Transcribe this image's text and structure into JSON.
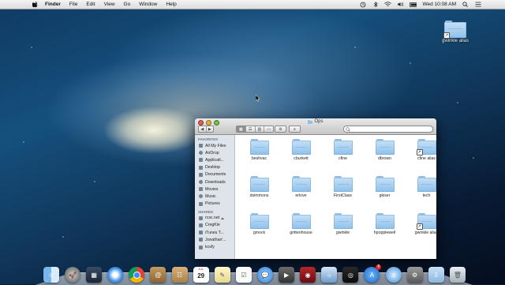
{
  "menubar": {
    "app_name": "Finder",
    "items": [
      "File",
      "Edit",
      "View",
      "Go",
      "Window",
      "Help"
    ],
    "clock": "Wed 10:08 AM"
  },
  "desktop_item": {
    "label": "gwinkle alias"
  },
  "window": {
    "title": "Ops",
    "search_placeholder": ""
  },
  "sidebar": {
    "favorites_heading": "FAVORITES",
    "favorites": [
      "All My Files",
      "AirDrop",
      "Applicati...",
      "Desktop",
      "Documents",
      "Downloads",
      "Movies",
      "Music",
      "Pictures"
    ],
    "shared_heading": "SHARED",
    "shared": [
      "rcsc.net",
      "CregKle",
      "iTunes T...",
      "Jonathan'...",
      "kcsfy"
    ]
  },
  "folders": [
    {
      "label": "beshvac",
      "alias": false
    },
    {
      "label": "cburkett",
      "alias": false
    },
    {
      "label": "cfine",
      "alias": false
    },
    {
      "label": "dbrown",
      "alias": false
    },
    {
      "label": "cfine alias",
      "alias": true
    },
    {
      "label": "dsimmons",
      "alias": false
    },
    {
      "label": "erlove",
      "alias": false
    },
    {
      "label": "FirstClass",
      "alias": false
    },
    {
      "label": "gkiser",
      "alias": false
    },
    {
      "label": "tech",
      "alias": false
    },
    {
      "label": "gmock",
      "alias": false
    },
    {
      "label": "grittenhouse",
      "alias": false
    },
    {
      "label": "gwinkle",
      "alias": false
    },
    {
      "label": "hpopplewell",
      "alias": false
    },
    {
      "label": "gwinkle alias",
      "alias": true
    }
  ],
  "dock": {
    "calendar_month": "JUL",
    "calendar_day": "29",
    "badge_count": "8",
    "icons": [
      "finder-icon",
      "launchpad-icon",
      "mission-control-icon",
      "safari-icon",
      "chrome-icon",
      "contacts-icon",
      "address-book-icon",
      "calendar-icon",
      "notes-icon",
      "reminders-icon",
      "messages-icon",
      "facetime-icon",
      "photo-booth-icon",
      "iphoto-icon",
      "dvd-player-icon",
      "app-store-icon",
      "itunes-icon",
      "system-preferences-icon",
      "downloads-stack-icon",
      "trash-icon"
    ]
  }
}
